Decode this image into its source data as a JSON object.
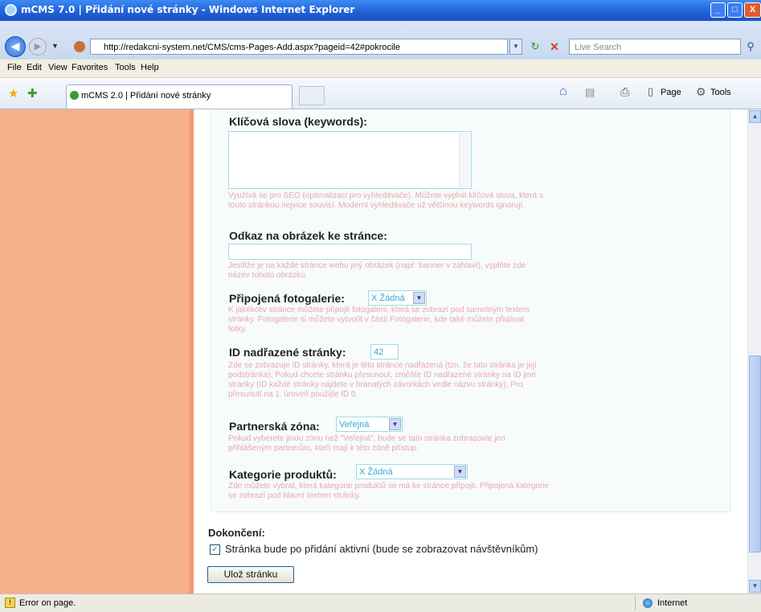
{
  "window": {
    "title": "mCMS 7.0 | Přidání nové stránky - Windows Internet Explorer",
    "minimize": "_",
    "maximize": "□",
    "close": "X"
  },
  "address_bar": {
    "url": "http://redakcni-system.net/CMS/cms-Pages-Add.aspx?pageid=42#pokrocile",
    "search_placeholder": "Live Search"
  },
  "menu": [
    "File",
    "Edit",
    "View",
    "Favorites",
    "Tools",
    "Help"
  ],
  "tab": {
    "label": "mCMS 2.0 | Přidání nové stránky"
  },
  "toolbar": {
    "page_label": "Page",
    "tools_label": "Tools"
  },
  "form": {
    "keywords": {
      "label": "Klíčová slova (keywords):",
      "help": "Využívá se pro SEO (optimalizaci pro vyhledávače). Můžete vyplnit klíčová slova, která s touto stránkou nejvíce souvisí. Moderní vyhledávače už většinou keywords ignorují."
    },
    "image_link": {
      "label": "Odkaz na obrázek ke stránce:",
      "help": "Jestliže je na každé stránce webu jiný obrázek (např. banner v záhlaví), vyplňte zde název tohoto obrázku."
    },
    "gallery": {
      "label": "Připojená fotogalerie:",
      "value": "X Žádná",
      "help": "K jakékoliv stránce můžete připojit fotogalerii, která se zobrazí pod samotným textem stránky. Fotogalerie si můžete vytvořit v části Fotogalerie, kde také můžete přidávat fotky."
    },
    "parent_id": {
      "label": "ID nadřazené stránky:",
      "value": "42",
      "help": "Zde se zobrazuje ID stránky, která je této stránce nadřazená (tzn. že tato stránka je její podstránka). Pokud chcete stránku přesunout, změňte ID nadřazené stránky na ID jiné stránky (ID každé stránky najdete v hranatých závorkách vedle názvu stránky). Pro přesunutí na 1. úroveň použijte ID 0."
    },
    "partner_zone": {
      "label": "Partnerská zóna:",
      "value": "Veřejná",
      "help": "Pokud vyberete jinou zónu než \"Veřejná\", bude se tato stránka zobrazovat jen přihlášeným partnerům, kteří mají k této zóně přístup."
    },
    "product_category": {
      "label": "Kategorie produktů:",
      "value": "X Žádná",
      "help": "Zde můžete vybrat, která kategorie produktů se má ke stránce připojit. Připojená kategorie se zobrazí pod hlavní textem stránky."
    }
  },
  "completion": {
    "heading": "Dokončení:",
    "checkbox_label": "Stránka bude po přidání aktivní (bude se zobrazovat návštěvníkům)",
    "checked": true,
    "save_button": "Ulož stránku"
  },
  "status_bar": {
    "message": "Error on page.",
    "zone": "Internet"
  }
}
